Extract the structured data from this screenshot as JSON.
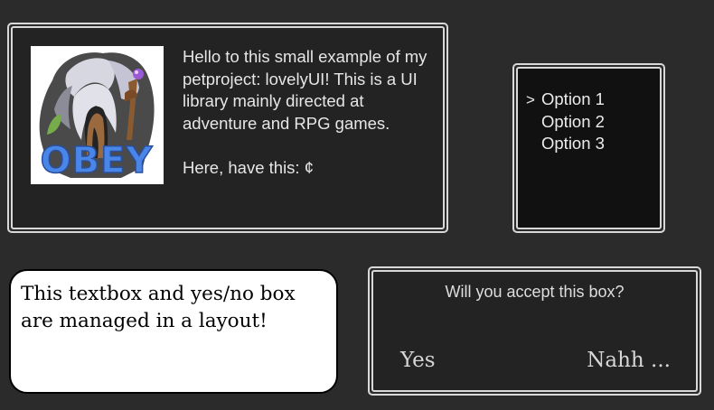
{
  "intro_dialog": {
    "portrait_icon": "obey-logo-portrait",
    "portrait_caption": "OBEY",
    "message_lines": [
      "Hello to this small example of my petproject: lovelyUI! This is a UI library mainly directed at adventure and RPG games.",
      "Here, have this: ¢"
    ]
  },
  "option_menu": {
    "cursor_glyph": ">",
    "options": [
      "Option 1",
      "Option 2",
      "Option 3"
    ],
    "selected_index": 0
  },
  "textbox": {
    "text": "This textbox and yes/no box are managed in a layout!"
  },
  "confirm_dialog": {
    "question": "Will you accept this box?",
    "yes_label": "Yes",
    "no_label": "Nahh ..."
  },
  "colors": {
    "background": "#2b2b2b",
    "panel": "#232323",
    "menu_panel": "#111111",
    "border": "#d8d8d8",
    "textbox": "#ffffff",
    "logo_text": "#4a86e8"
  }
}
